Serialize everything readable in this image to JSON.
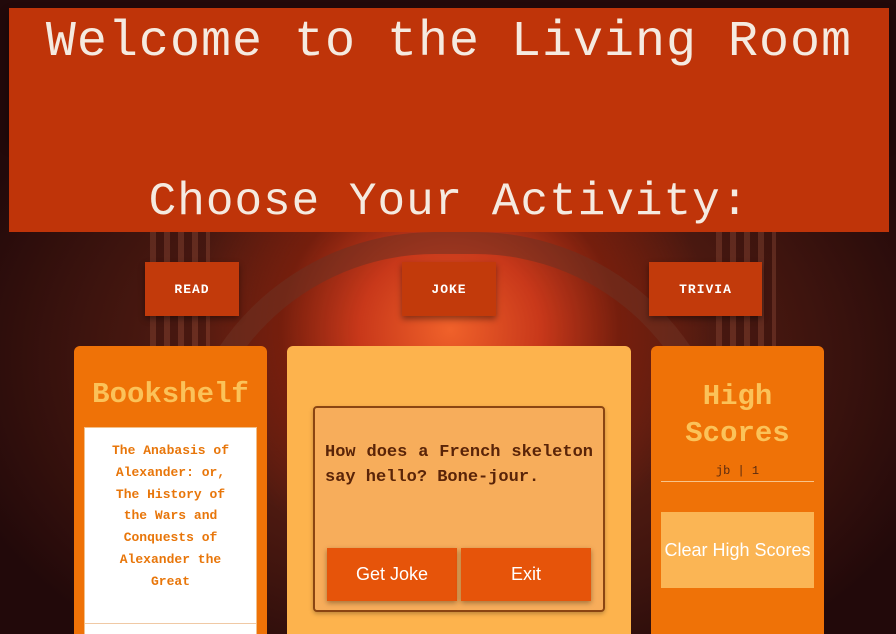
{
  "header": {
    "title": "Welcome to the Living Room",
    "subtitle": "Choose Your Activity:"
  },
  "activities": {
    "read_label": "READ",
    "joke_label": "JOKE",
    "trivia_label": "TRIVIA"
  },
  "bookshelf": {
    "title": "Bookshelf",
    "book_title": "The Anabasis of Alexander: or, The History of the Wars and Conquests of Alexander the Great"
  },
  "joke": {
    "text": "How does a French skeleton say hello? Bone-jour.",
    "get_joke_label": "Get Joke",
    "exit_label": "Exit"
  },
  "high_scores": {
    "title": "High Scores",
    "entries": [
      "jb | 1"
    ],
    "clear_label": "Clear High Scores"
  },
  "colors": {
    "header_bg": "#bf3409",
    "panel_orange": "#ef7207",
    "panel_light": "#fdb34d",
    "button_dark": "#e6540a",
    "accent_text": "#fbc259"
  }
}
